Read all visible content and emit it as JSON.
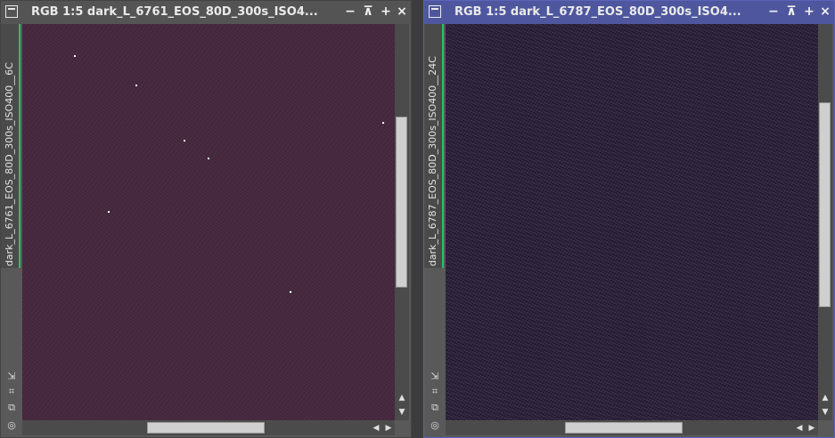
{
  "windows": [
    {
      "title": "RGB 1:5 dark_L_6761_EOS_80D_300s_ISO4...",
      "side_label": "dark_L_6761_EOS_80D_300s_ISO400__6C",
      "active": false,
      "controls": {
        "minimize": "−",
        "shade": "⊼",
        "maximize": "+",
        "close": "×"
      }
    },
    {
      "title": "RGB 1:5 dark_L_6787_EOS_80D_300s_ISO4...",
      "side_label": "dark_L_6787_EOS_80D_300s_ISO400__24C",
      "active": true,
      "controls": {
        "minimize": "−",
        "shade": "⊼",
        "maximize": "+",
        "close": "×"
      }
    }
  ],
  "icons": [
    "window-icon",
    "minimize-icon",
    "shade-icon",
    "maximize-icon",
    "close-icon",
    "fit-view-icon",
    "crosshair-icon",
    "clone-icon",
    "zoom-circle-icon",
    "arrow-up-icon",
    "arrow-down-icon",
    "arrow-left-icon",
    "arrow-right-icon"
  ],
  "colors": {
    "active_titlebar": "#4e579e",
    "inactive_titlebar": "#545454",
    "tab_accent": "#2bbf6a",
    "image1_bg": "#46283e",
    "image2_bg": "#231a2e"
  }
}
